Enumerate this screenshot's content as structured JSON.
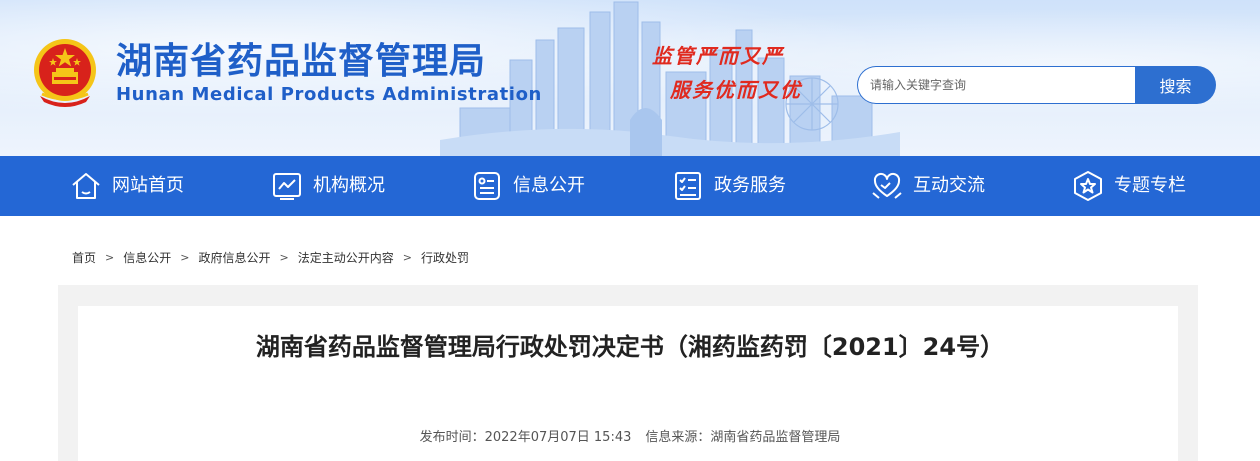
{
  "header": {
    "site_title": "湖南省药品监督管理局",
    "site_subtitle": "Hunan Medical Products Administration",
    "slogan_line1": "监管严而又严",
    "slogan_line2": "服务优而又优",
    "search": {
      "placeholder": "请输入关键字查询",
      "button_label": "搜索"
    }
  },
  "nav": {
    "items": [
      {
        "label": "网站首页",
        "icon": "home-icon"
      },
      {
        "label": "机构概况",
        "icon": "chart-monitor-icon"
      },
      {
        "label": "信息公开",
        "icon": "document-icon"
      },
      {
        "label": "政务服务",
        "icon": "checklist-icon"
      },
      {
        "label": "互动交流",
        "icon": "heart-hands-icon"
      },
      {
        "label": "专题专栏",
        "icon": "star-badge-icon"
      }
    ]
  },
  "breadcrumb": {
    "items": [
      "首页",
      "信息公开",
      "政府信息公开",
      "法定主动公开内容",
      "行政处罚"
    ],
    "separator": ">"
  },
  "article": {
    "title": "湖南省药品监督管理局行政处罚决定书（湘药监药罚〔2021〕24号）",
    "publish_time": "发布时间：2022年07月07日 15:43",
    "source": "信息来源：湖南省药品监督管理局"
  },
  "colors": {
    "brand_blue": "#2467d5",
    "title_blue": "#1f5fc8",
    "slogan_red": "#e02a1f",
    "emblem_red": "#d8221b",
    "emblem_gold": "#f5c518"
  }
}
